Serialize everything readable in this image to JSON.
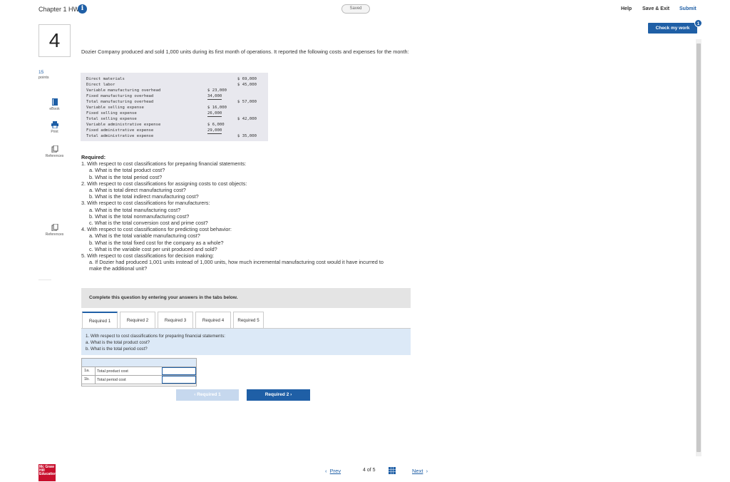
{
  "header": {
    "chapter_title": "Chapter 1 HW",
    "info_icon": "i",
    "saved_label": "Saved",
    "help": "Help",
    "save_exit": "Save & Exit",
    "submit": "Submit",
    "check_my_work": "Check my work",
    "check_badge": "1"
  },
  "question": {
    "number": "4",
    "points_value": "15",
    "points_label": "points",
    "intro": "Dozier Company produced and sold 1,000 units during its first month of operations. It reported the following costs and expenses for the month:"
  },
  "sidebar": {
    "tools": [
      {
        "label": "eBook",
        "icon": "book-icon"
      },
      {
        "label": "Print",
        "icon": "print-icon"
      },
      {
        "label": "References",
        "icon": "references-icon"
      }
    ],
    "references2": "References",
    "dashes": "·········"
  },
  "fin": {
    "rows": [
      {
        "label": "Direct materials",
        "c1": "",
        "c2": "$ 69,000"
      },
      {
        "label": "Direct labor",
        "c1": "",
        "c2": "$ 45,000"
      },
      {
        "label": "Variable manufacturing overhead",
        "c1": "$ 23,000",
        "c2": ""
      },
      {
        "label": "Fixed manufacturing overhead",
        "c1": "34,000",
        "c2": ""
      },
      {
        "label": "Total manufacturing overhead",
        "c1": "",
        "c2": "$ 57,000"
      },
      {
        "label": "Variable selling expense",
        "c1": "$ 16,000",
        "c2": ""
      },
      {
        "label": "Fixed selling expense",
        "c1": "26,000",
        "c2": ""
      },
      {
        "label": "Total selling expense",
        "c1": "",
        "c2": "$ 42,000"
      },
      {
        "label": "Variable administrative expense",
        "c1": "$  6,000",
        "c2": ""
      },
      {
        "label": "Fixed administrative expense",
        "c1": "29,000",
        "c2": ""
      },
      {
        "label": "Total administrative expense",
        "c1": "",
        "c2": "$ 35,000"
      }
    ]
  },
  "required": {
    "title": "Required:",
    "lines": [
      {
        "t": "1. With respect to cost classifications for preparing financial statements:",
        "lvl": 1
      },
      {
        "t": "a. What is the total product cost?",
        "lvl": 2
      },
      {
        "t": "b. What is the total period cost?",
        "lvl": 2
      },
      {
        "t": "2. With respect to cost classifications for assigning costs to cost objects:",
        "lvl": 1
      },
      {
        "t": "a. What is total direct manufacturing cost?",
        "lvl": 2
      },
      {
        "t": "b. What is the total indirect manufacturing cost?",
        "lvl": 2
      },
      {
        "t": "3. With respect to cost classifications for manufacturers:",
        "lvl": 1
      },
      {
        "t": "a. What is the total manufacturing cost?",
        "lvl": 2
      },
      {
        "t": "b. What is the total nonmanufacturing cost?",
        "lvl": 2
      },
      {
        "t": "c. What is the total conversion cost and prime cost?",
        "lvl": 2
      },
      {
        "t": "4. With respect to cost classifications for predicting cost behavior:",
        "lvl": 1
      },
      {
        "t": "a. What is the total variable manufacturing cost?",
        "lvl": 2
      },
      {
        "t": "b. What is the total fixed cost for the company as a whole?",
        "lvl": 2
      },
      {
        "t": "c. What is the variable cost per unit produced and sold?",
        "lvl": 2
      },
      {
        "t": "5. With respect to cost classifications for decision making:",
        "lvl": 1
      },
      {
        "t": "a. If Dozier had produced 1,001 units instead of 1,000 units, how much incremental manufacturing cost would it have incurred to",
        "lvl": 2
      },
      {
        "t": "make the additional unit?",
        "lvl": 2
      }
    ]
  },
  "complete": "Complete this question by entering your answers in the tabs below.",
  "tabs": [
    "Required 1",
    "Required 2",
    "Required 3",
    "Required 4",
    "Required 5"
  ],
  "panel": {
    "line1": "1. With respect to cost classifications for preparing financial statements:",
    "line2": "a. What is the total product cost?",
    "line3": "b. What is the total period cost?"
  },
  "answers": [
    {
      "id": "1a.",
      "label": "Total product cost",
      "value": ""
    },
    {
      "id": "1b.",
      "label": "Total period cost",
      "value": ""
    }
  ],
  "nav": {
    "prev": "‹  Required 1",
    "next": "Required 2  ›"
  },
  "footer": {
    "logo": "Mc Graw Hill Education",
    "prev": "Prev",
    "count": "4 of 5",
    "next": "Next"
  },
  "colors": {
    "accent": "#1f5fa6",
    "panel_bg": "#dce9f7",
    "logo_red": "#c8102e"
  }
}
